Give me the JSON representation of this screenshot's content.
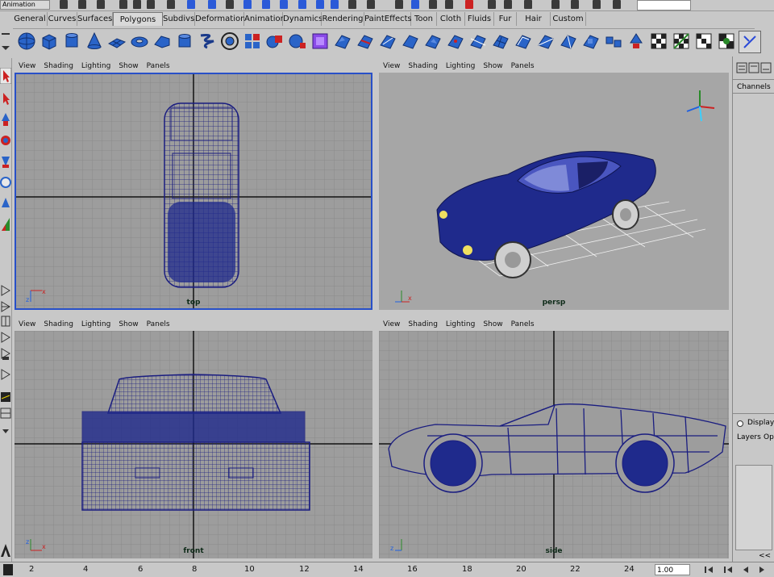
{
  "window": {
    "mode_menu": "Animation"
  },
  "shelf": {
    "tabs": [
      "General",
      "Curves",
      "Surfaces",
      "Polygons",
      "Subdivs",
      "Deformation",
      "Animation",
      "Dynamics",
      "Rendering",
      "PaintEffects",
      "Toon",
      "Cloth",
      "Fluids",
      "Fur",
      "Hair",
      "Custom"
    ],
    "active_tab": "Polygons"
  },
  "viewport_menu": {
    "view": "View",
    "shading": "Shading",
    "lighting": "Lighting",
    "show": "Show",
    "panels": "Panels"
  },
  "viewports": {
    "top": {
      "label": "top",
      "active": true
    },
    "persp": {
      "label": "persp",
      "active": false
    },
    "front": {
      "label": "front",
      "active": false
    },
    "side": {
      "label": "side",
      "active": false
    }
  },
  "channel_box": {
    "channels_tab": "Channels"
  },
  "layer_editor": {
    "display_radio": "Display",
    "layers_menu": "Layers",
    "options_menu": "Op"
  },
  "timeline": {
    "ticks": [
      "2",
      "4",
      "6",
      "8",
      "10",
      "12",
      "14",
      "16",
      "18",
      "20",
      "22",
      "24"
    ],
    "current_time": "1.00",
    "collapse_glyph": "<<"
  },
  "colors": {
    "grid_bg": "#9d9d9d",
    "wire": "#1a1d80",
    "active_border": "#2850c8",
    "car_body": "#1f2a8c"
  }
}
